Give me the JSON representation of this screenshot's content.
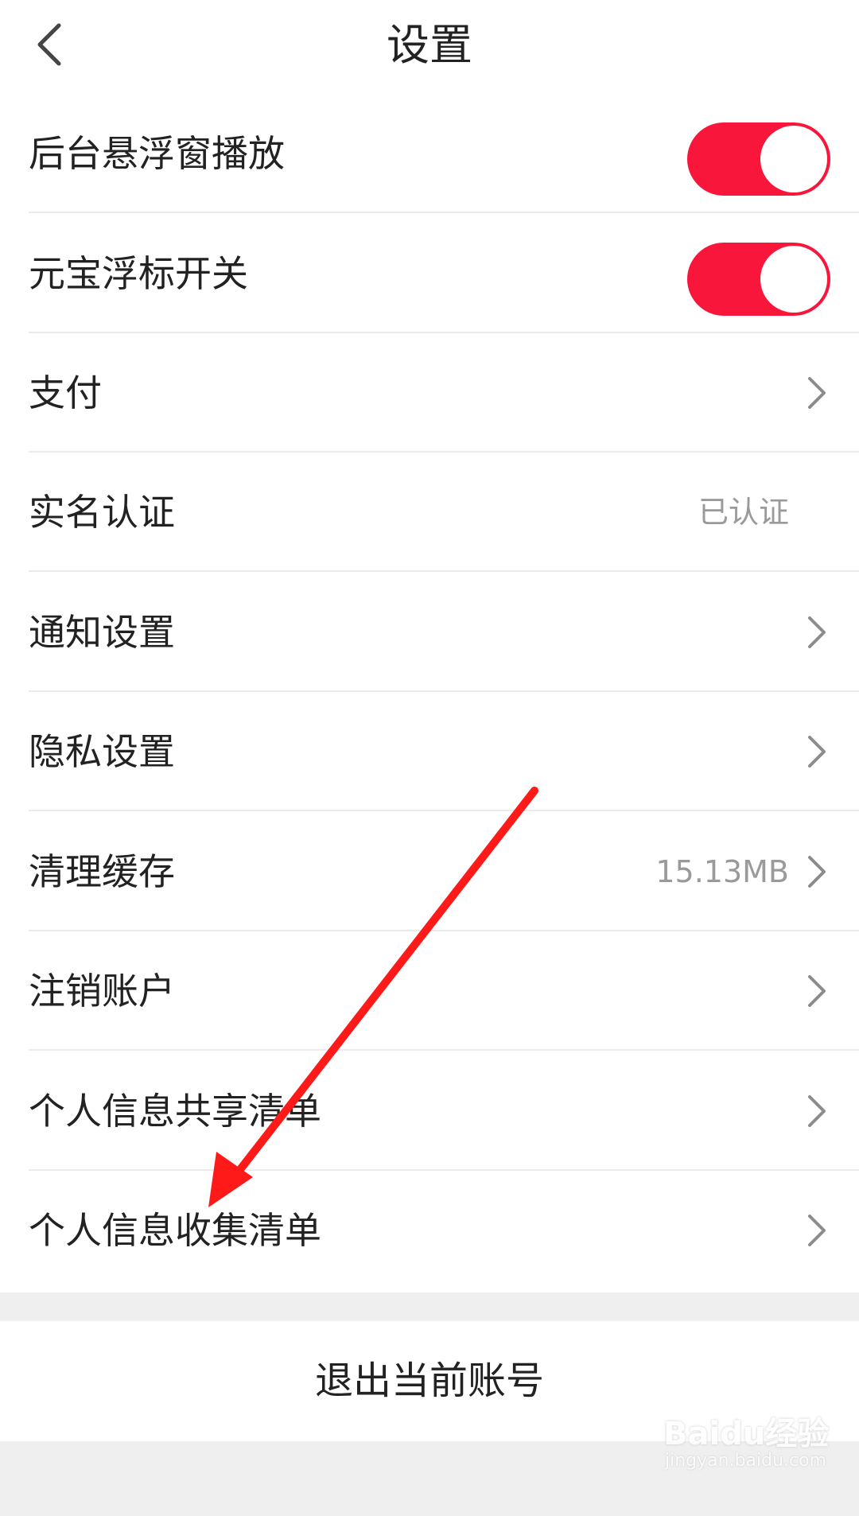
{
  "header": {
    "title": "设置",
    "back_icon": "chevron-left-icon"
  },
  "settings": {
    "items": [
      {
        "label": "后台悬浮窗播放",
        "control": "toggle",
        "toggle_on": true
      },
      {
        "label": "元宝浮标开关",
        "control": "toggle",
        "toggle_on": true
      },
      {
        "label": "支付",
        "control": "chevron"
      },
      {
        "label": "实名认证",
        "control": "value",
        "value": "已认证"
      },
      {
        "label": "通知设置",
        "control": "chevron"
      },
      {
        "label": "隐私设置",
        "control": "chevron"
      },
      {
        "label": "清理缓存",
        "control": "value-chevron",
        "value": "15.13MB"
      },
      {
        "label": "注销账户",
        "control": "chevron"
      },
      {
        "label": "个人信息共享清单",
        "control": "chevron"
      },
      {
        "label": "个人信息收集清单",
        "control": "chevron"
      }
    ]
  },
  "logout": {
    "label": "退出当前账号"
  },
  "annotation": {
    "type": "arrow",
    "color": "#ff1a1a",
    "points_to": "个人信息收集清单"
  },
  "watermark": {
    "brand": "Baidu经验",
    "url": "jingyan.baidu.com"
  },
  "colors": {
    "accent": "#f8173a",
    "text": "#222222",
    "secondary_text": "#9a9a9a",
    "background": "#efefef"
  }
}
